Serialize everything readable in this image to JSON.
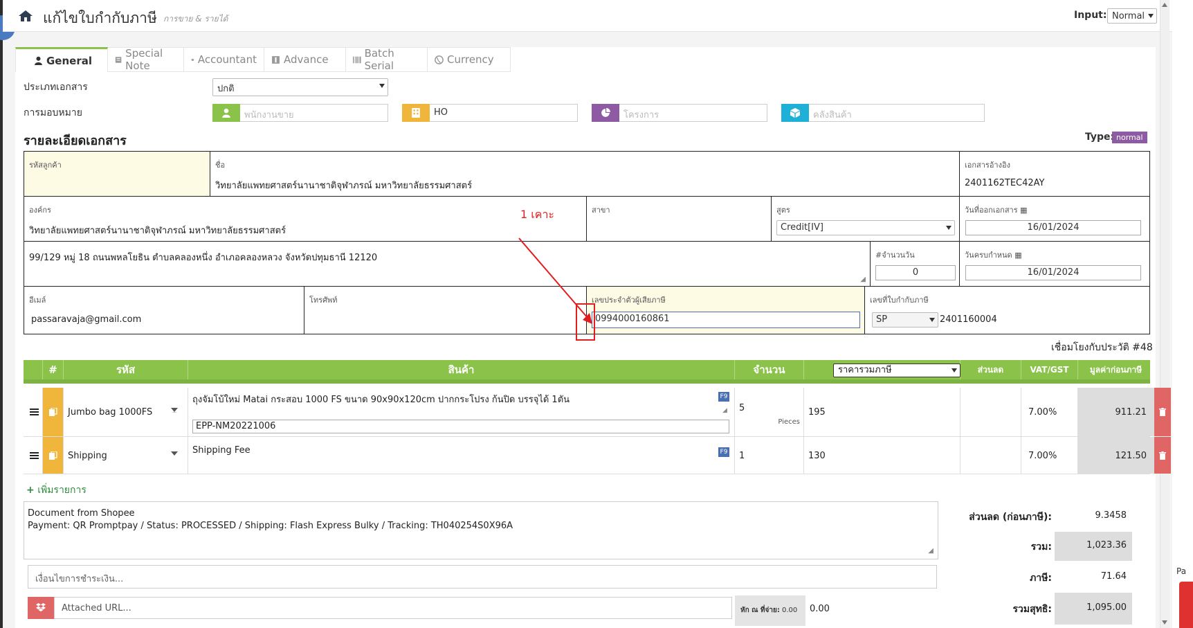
{
  "header": {
    "title": "แก้ไขใบกำกับภาษี",
    "subtitle": "การขาย & รายได้",
    "input_label": "Input:",
    "input_value": "Normal"
  },
  "tabs": [
    {
      "label": "General",
      "icon": "user-icon"
    },
    {
      "label": "Special Note",
      "icon": "note-icon"
    },
    {
      "label": "Accountant",
      "icon": "graduation-cap-icon"
    },
    {
      "label": "Advance",
      "icon": "advance-icon"
    },
    {
      "label": "Batch Serial",
      "icon": "barcode-icon"
    },
    {
      "label": "Currency",
      "icon": "globe-icon"
    }
  ],
  "form": {
    "doc_type_label": "ประเภทเอกสาร",
    "doc_type_value": "ปกติ",
    "assign_label": "การมอบหมาย",
    "salesperson_placeholder": "พนักงานขาย",
    "branch_value": "HO",
    "project_placeholder": "โครงการ",
    "warehouse_placeholder": "คลังสินค้า",
    "colors": {
      "green": "#8bc34a",
      "yellow": "#f0b63c",
      "purple": "#8e5aa4",
      "cyan": "#1fb0d8"
    }
  },
  "details": {
    "title": "รายละเอียดเอกสาร",
    "type_label": "Type:",
    "type_value": "normal",
    "customer_code_label": "รหัสลูกค้า",
    "name_label": "ชื่อ",
    "name_value": "วิทยาลัยแพทยศาสตร์นานาชาติจุฬาภรณ์ มหาวิทยาลัยธรรมศาสตร์",
    "ref_doc_label": "เอกสารอ้างอิง",
    "ref_doc_value": "2401162TEC42AY",
    "org_label": "องค์กร",
    "org_value": "วิทยาลัยแพทยศาสตร์นานาชาติจุฬาภรณ์ มหาวิทยาลัยธรรมศาสตร์",
    "branch_label": "สาขา",
    "formula_label": "สูตร",
    "formula_value": "Credit[IV]",
    "issue_date_label": "วันที่ออกเอกสาร",
    "issue_date_value": "16/01/2024",
    "address_value": "99/129 หมู่ 18 ถนนพหลโยธิน ตำบลคลองหนึ่ง อำเภอคลองหลวง จังหวัดปทุมธานี 12120",
    "days_label": "#จำนวนวัน",
    "days_value": "0",
    "due_date_label": "วันครบกำหนด",
    "due_date_value": "16/01/2024",
    "email_label": "อีเมล์",
    "email_value": "passaravaja@gmail.com",
    "phone_label": "โทรศัพท์",
    "tax_id_label": "เลขประจำตัวผู้เสียภาษี",
    "tax_id_value": "0994000160861",
    "invoice_no_label": "เลขที่ใบกำกับภาษี",
    "invoice_prefix": "SP",
    "invoice_no_value": "2401160004",
    "history_link": "เชื่อมโยงกับประวัติ #48"
  },
  "annotation": {
    "text": "1 เคาะ",
    "color": "#e21d1d"
  },
  "table": {
    "headers": {
      "num": "#",
      "code": "รหัส",
      "product": "สินค้า",
      "qty": "จำนวน",
      "price_mode": "ราคารวมภาษี",
      "discount": "ส่วนลด",
      "vat": "VAT/GST",
      "amount": "มูลค่าก่อนภาษี"
    },
    "rows": [
      {
        "code": "Jumbo bag 1000FS",
        "product": "ถุงจัมโบ้ใหม่ Matai กระสอบ 1000 FS ขนาด 90x90x120cm ปากกระโปรง ก้นปิด บรรจุได้ 1ตัน",
        "serial": "EPP-NM20221006",
        "f9": "F9",
        "qty": "5",
        "unit": "Pieces",
        "price": "195",
        "vat": "7.00%",
        "amount": "911.21"
      },
      {
        "code": "Shipping",
        "product": "Shipping Fee",
        "f9": "F9",
        "qty": "1",
        "price": "130",
        "vat": "7.00%",
        "amount": "121.50"
      }
    ],
    "add_item": "เพิ่มรายการ"
  },
  "notes": {
    "line1": "Document from Shopee",
    "line2": "Payment: QR Promptpay / Status: PROCESSED / Shipping: Flash Express Bulky / Tracking: TH040254S0X96A"
  },
  "summary": {
    "discount_label": "ส่วนลด (ก่อนภาษี):",
    "discount_value": "9.3458",
    "total_label": "รวม:",
    "total_value": "1,023.36",
    "tax_label": "ภาษี:",
    "tax_value": "71.64",
    "net_label": "รวมสุทธิ:",
    "net_value": "1,095.00"
  },
  "payment": {
    "condition_placeholder": "เงื่อนไขการชำระเงิน...",
    "url_placeholder": "Attached URL...",
    "wht_label": "หัก ณ ที่จ่าย:",
    "wht_pct": "0.00",
    "wht_value": "0.00"
  },
  "side": {
    "pa_text": "Pa"
  }
}
